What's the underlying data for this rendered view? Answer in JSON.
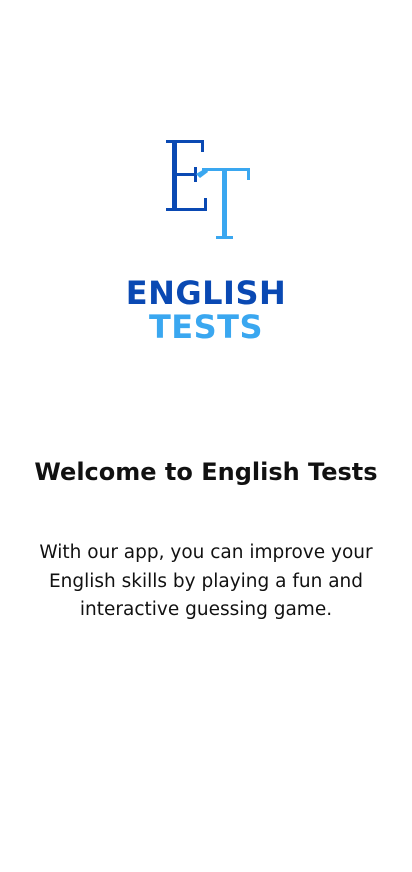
{
  "logo": {
    "icon": "et-monogram-logo",
    "letters": [
      "E",
      "T"
    ],
    "colors": {
      "dark_blue": "#0a49b3",
      "light_blue": "#3aa7f0"
    }
  },
  "brand": {
    "line1": "ENGLISH",
    "line2": "TESTS",
    "line1_color": "#0a49b3",
    "line2_color": "#3aa7f0"
  },
  "welcome": {
    "title": "Welcome to English Tests",
    "description": "With our app, you can improve your English skills by playing a fun and interactive guessing game."
  }
}
